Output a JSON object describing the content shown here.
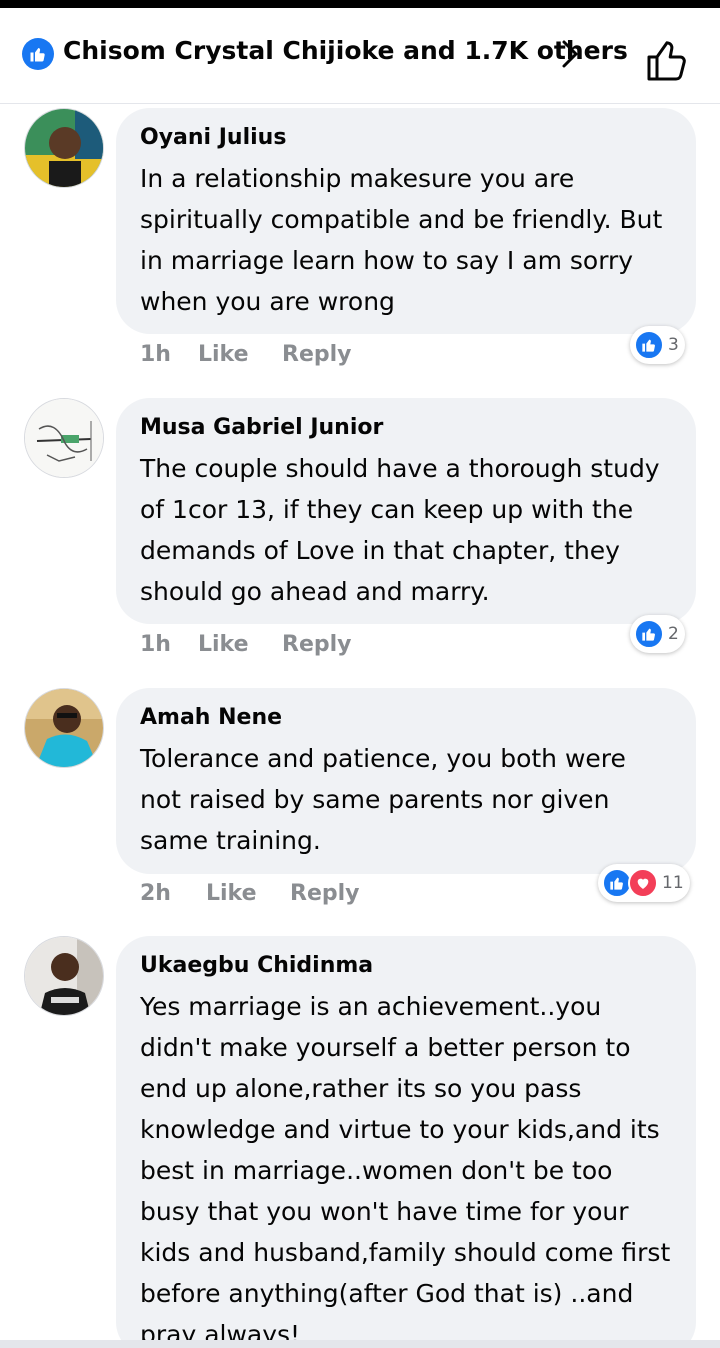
{
  "header": {
    "reactors_text": "Chisom Crystal Chijioke and 1.7K others"
  },
  "colors": {
    "accent": "#1877f2",
    "love": "#f33e58",
    "bubble": "#f0f2f5",
    "meta_text": "#8a8d91"
  },
  "comments": [
    {
      "author": "Oyani Julius",
      "text": "In a relationship makesure you are spiritually compatible and be friendly.  But in marriage learn how to say I am sorry when you are wrong",
      "time": "1h",
      "like_label": "Like",
      "reply_label": "Reply",
      "reactions": [
        "like-icon"
      ],
      "reaction_count": "3"
    },
    {
      "author": "Musa Gabriel Junior",
      "text": "The couple should have a thorough study of 1cor 13, if they can keep up with the demands of Love in that chapter, they should go ahead and marry.",
      "time": "1h",
      "like_label": "Like",
      "reply_label": "Reply",
      "reactions": [
        "like-icon"
      ],
      "reaction_count": "2"
    },
    {
      "author": "Amah Nene",
      "text": "Tolerance and patience, you both were not raised by same parents nor given same training.",
      "time": "2h",
      "like_label": "Like",
      "reply_label": "Reply",
      "reactions": [
        "like-icon",
        "love-icon"
      ],
      "reaction_count": "11"
    },
    {
      "author": "Ukaegbu Chidinma",
      "text": "Yes marriage is an achievement..you didn't make yourself a better person to end up alone,rather its so you pass knowledge and virtue to your kids,and its best in marriage..women don't be too busy that you won't have time for your kids and husband,family should come first before anything(after God that is) ..and pray always!"
    }
  ]
}
